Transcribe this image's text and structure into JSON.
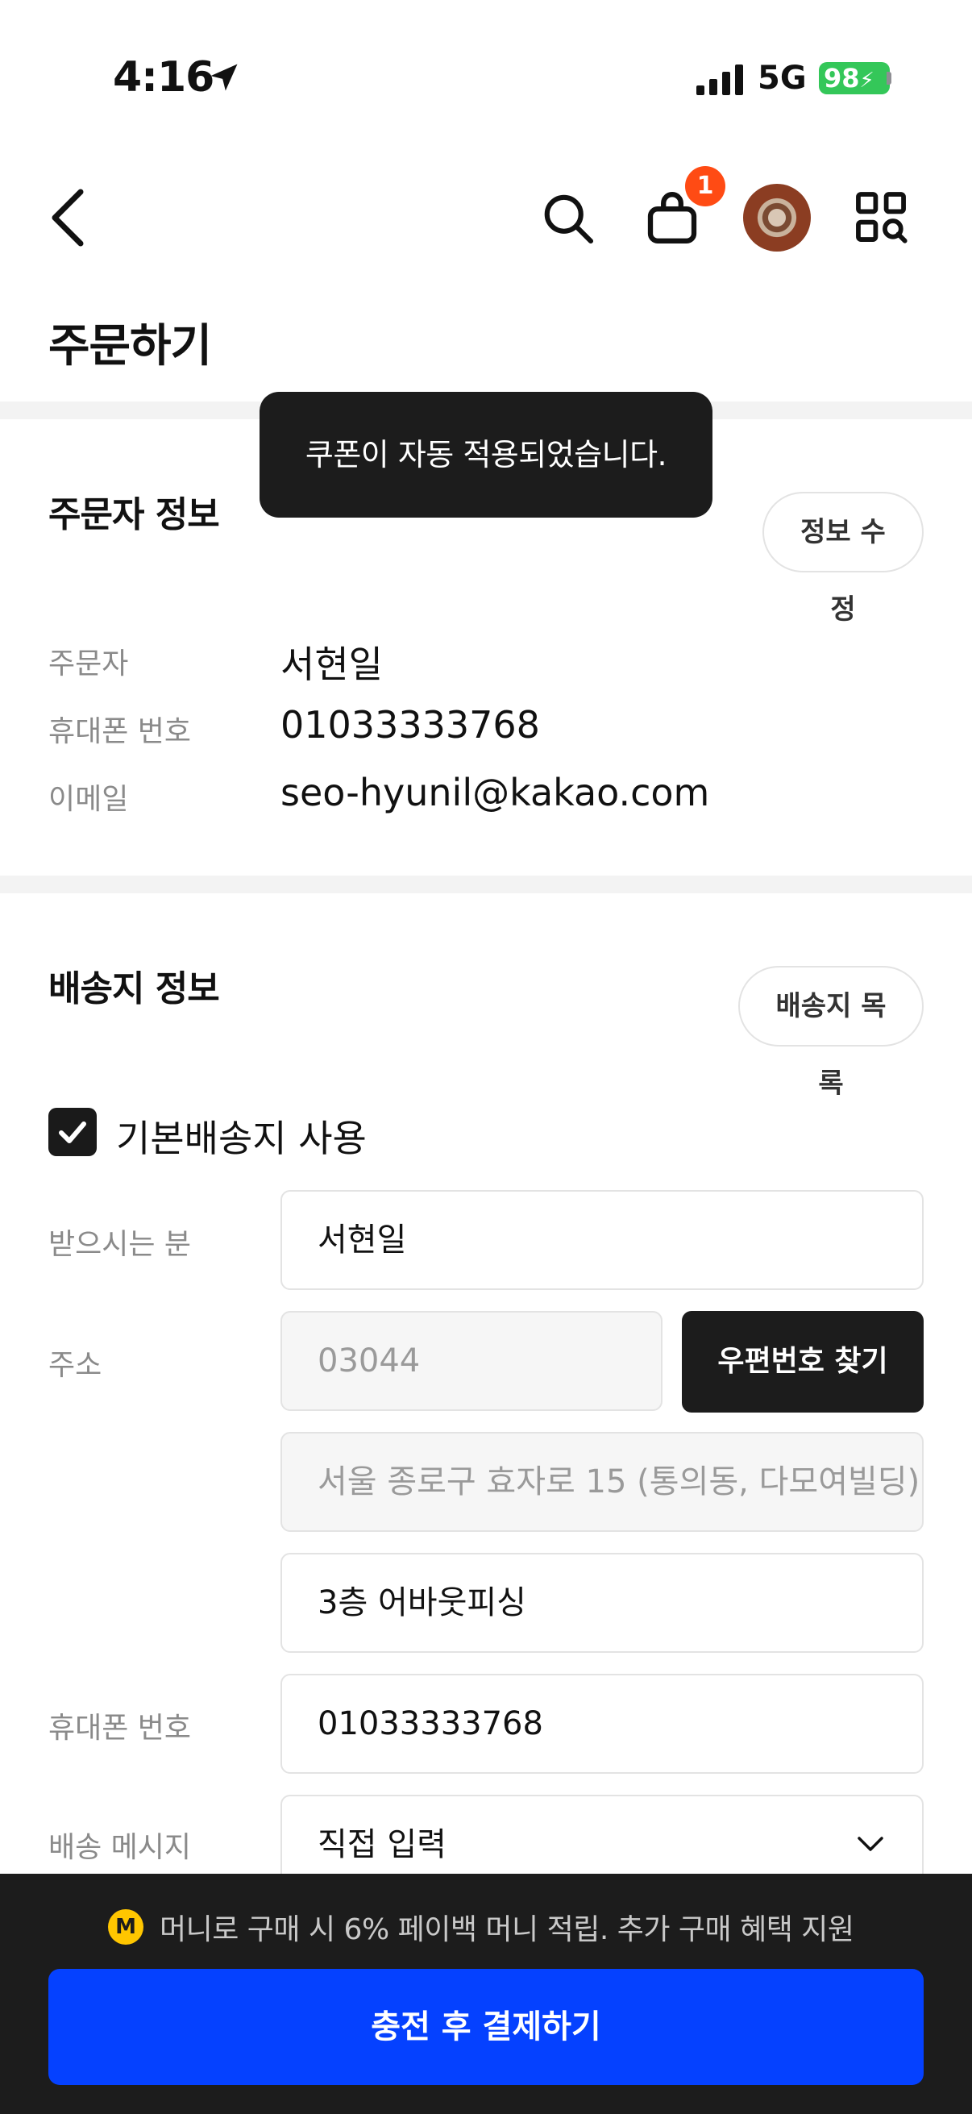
{
  "status_bar": {
    "time": "4:16",
    "network": "5G",
    "battery": "98",
    "icons": [
      "location-arrow-icon",
      "signal-icon",
      "battery-charging-icon"
    ]
  },
  "header": {
    "icons": [
      "back-icon",
      "search-icon",
      "cart-icon",
      "avatar",
      "grid-search-icon"
    ],
    "cart_count": "1"
  },
  "page": {
    "title": "주문하기"
  },
  "toast": {
    "message": "쿠폰이 자동 적용되었습니다."
  },
  "orderer": {
    "title": "주문자 정보",
    "edit_button": "정보 수정",
    "rows": [
      {
        "label": "주문자",
        "value": "서현일"
      },
      {
        "label": "휴대폰 번호",
        "value": "01033333768"
      },
      {
        "label": "이메일",
        "value": "seo-hyunil@kakao.com"
      }
    ]
  },
  "shipping": {
    "title": "배송지 정보",
    "list_button": "배송지 목록",
    "default_checkbox_label": "기본배송지 사용",
    "default_checked": true,
    "recipient_label": "받으시는 분",
    "recipient_value": "서현일",
    "address_label": "주소",
    "zipcode": "03044",
    "zipcode_button": "우편번호 찾기",
    "address1": "서울 종로구 효자로 15 (통의동, 다모여빌딩)",
    "address2": "3층 어바웃피싱",
    "phone_label": "휴대폰 번호",
    "phone_value": "01033333768",
    "message_label": "배송 메시지",
    "message_value": "직접 입력"
  },
  "bottom": {
    "payback_icon_letter": "M",
    "payback_text": "머니로 구매 시 6% 페이백 머니 적립. 추가 구매 혜택 지원",
    "pay_button": "충전 후 결제하기"
  },
  "colors": {
    "primary": "#0541ff",
    "dark": "#1c1c1c",
    "badge": "#ff4b14",
    "battery": "#34c759",
    "coin": "#ffc600"
  }
}
